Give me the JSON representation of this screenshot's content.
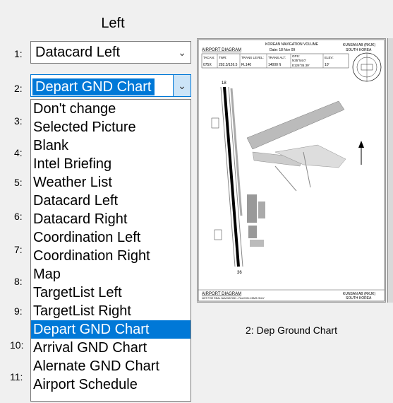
{
  "panel": {
    "title": "Left"
  },
  "rows": [
    {
      "num": "1:"
    },
    {
      "num": "2:"
    },
    {
      "num": "3:"
    },
    {
      "num": "4:"
    },
    {
      "num": "5:"
    },
    {
      "num": "6:"
    },
    {
      "num": "7:"
    },
    {
      "num": "8:"
    },
    {
      "num": "9:"
    },
    {
      "num": "10:"
    },
    {
      "num": "11:"
    }
  ],
  "combo1": {
    "value": "Datacard Left",
    "chevron": "chevron-down-icon"
  },
  "combo2": {
    "value": "Depart GND Chart",
    "chevron": "chevron-down-icon"
  },
  "dropdown": {
    "options": [
      "Don't change",
      "Selected Picture",
      "Blank",
      "Intel Briefing",
      "Weather List",
      "Datacard Left",
      "Datacard Right",
      "Coordination Left",
      "Coordination Right",
      "Map",
      "TargetList Left",
      "TargetList Right",
      "Depart GND Chart",
      "Arrival GND Chart",
      "Alernate GND Chart",
      "Airport Schedule"
    ],
    "selected": "Depart GND Chart",
    "selection_color": "#0078d7"
  },
  "chart": {
    "header_top": "KOREAN NAVIGATION VOLUME",
    "header_left": "AIRPORT DIAGRAM",
    "header_date": "Date: 18 Nov 09",
    "header_right_1": "KUNSAN AB (RKJK)",
    "header_right_2": "SOUTH KOREA",
    "info": [
      {
        "k": "TACAN:",
        "v": "075X"
      },
      {
        "k": "TWR:",
        "v": "292.3/126.5"
      },
      {
        "k": "TRANS LEVEL:",
        "v": "FL140"
      },
      {
        "k": "TRANS ALT:",
        "v": "14000 ft"
      },
      {
        "k": "GPS:",
        "v": "N35°54.0'"
      },
      {
        "k": "ELEV:",
        "v": "10'"
      }
    ],
    "gps2": "E126°35.39'",
    "footer_left": "AIRPORT DIAGRAM",
    "footer_note": "NOT FOR REAL NAVIGATION - FALCON 4 BMS ONLY",
    "footer_right_1": "KUNSAN AB (RKJK)",
    "footer_right_2": "SOUTH KOREA",
    "runway_top": "18",
    "runway_bottom": "36",
    "caption": "2: Dep Ground Chart"
  }
}
